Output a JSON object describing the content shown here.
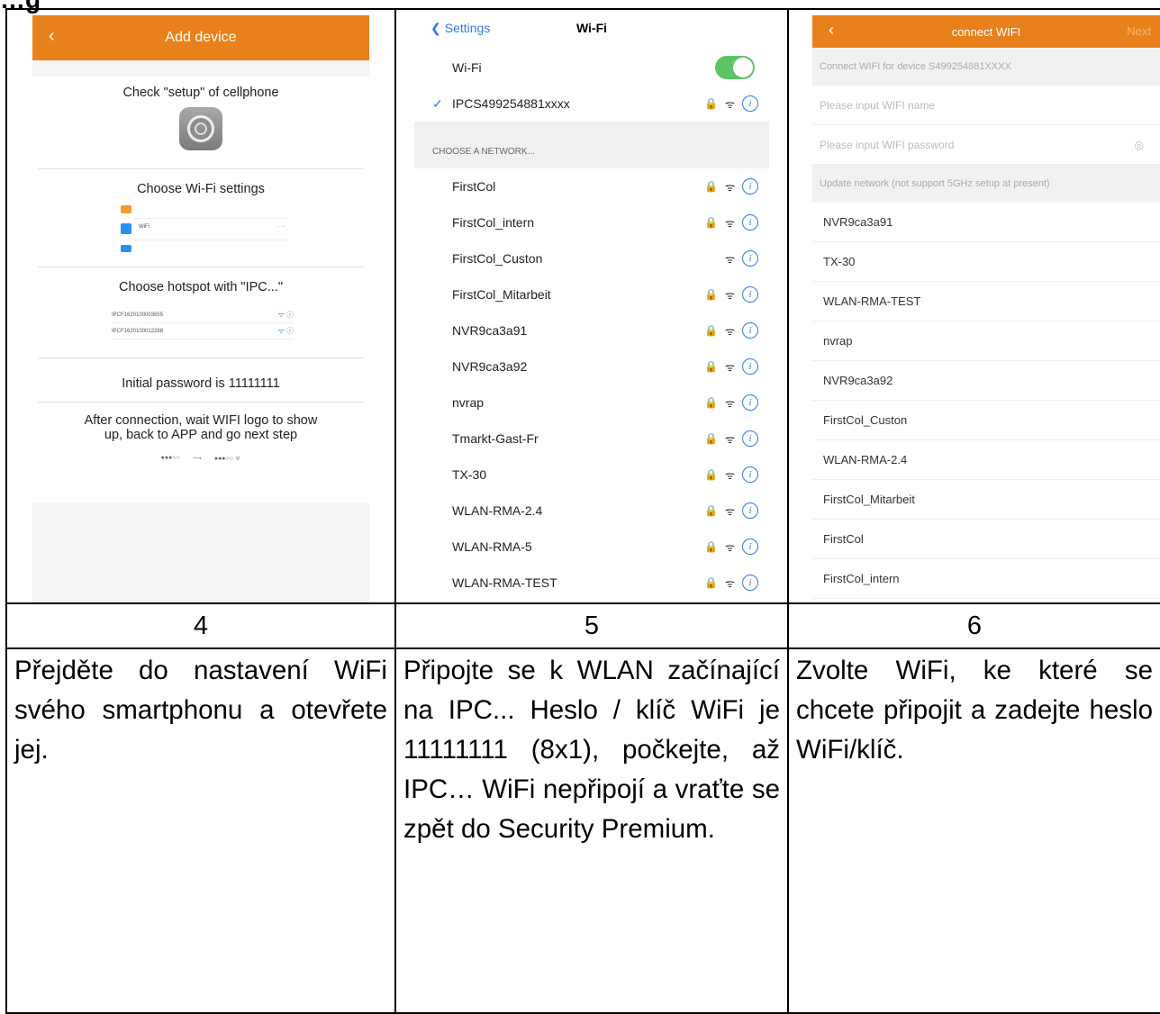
{
  "heading": "…g",
  "screen1": {
    "title": "Add device",
    "back": "‹",
    "step1": "Check \"setup\" of cellphone",
    "step2": "Choose Wi-Fi settings",
    "mini_wifi_label": "WiFi",
    "step3": "Choose hotspot with \"IPC...\"",
    "mini_list": [
      "IPCF1620100003655",
      "IPCF1620100012268"
    ],
    "step4": "Initial password is 11111111",
    "step5a": "After connection, wait WIFI logo to show",
    "step5b": "up, back to APP and go next step"
  },
  "screen2": {
    "back_label": "Settings",
    "title": "Wi-Fi",
    "wifi_label": "Wi-Fi",
    "connected": "IPCS499254881xxxx",
    "section": "CHOOSE A NETWORK...",
    "networks": [
      "FirstCol",
      "FirstCol_intern",
      "FirstCol_Custon",
      "FirstCol_Mitarbeit",
      "NVR9ca3a91",
      "NVR9ca3a92",
      "nvrap",
      "Tmarkt-Gast-Fr",
      "TX-30",
      "WLAN-RMA-2.4",
      "WLAN-RMA-5",
      "WLAN-RMA-TEST"
    ]
  },
  "screen3": {
    "title": "connect WIFI",
    "back": "‹",
    "next": "Next",
    "device_line": "Connect WIFI for device S499254881XXXX",
    "name_placeholder": "Please input WIFI name",
    "pass_placeholder": "Please input WIFI password",
    "update_line": "Update network (not support 5GHz setup at present)",
    "networks": [
      "NVR9ca3a91",
      "TX-30",
      "WLAN-RMA-TEST",
      "nvrap",
      "NVR9ca3a92",
      "FirstCol_Custon",
      "WLAN-RMA-2.4",
      "FirstCol_Mitarbeit",
      "FirstCol",
      "FirstCol_intern"
    ]
  },
  "steps": [
    "4",
    "5",
    "6"
  ],
  "descriptions": [
    "Přejděte do nastavení WiFi svého smartphonu a otevřete jej.",
    "Připojte se k WLAN začínající na IPC... Heslo / klíč WiFi je 11111111 (8x1), počkejte, až IPC… WiFi nepřipojí a vraťte se zpět do Security Premium.",
    "Zvolte WiFi, ke které se chcete připojit a zadejte heslo WiFi/klíč."
  ]
}
